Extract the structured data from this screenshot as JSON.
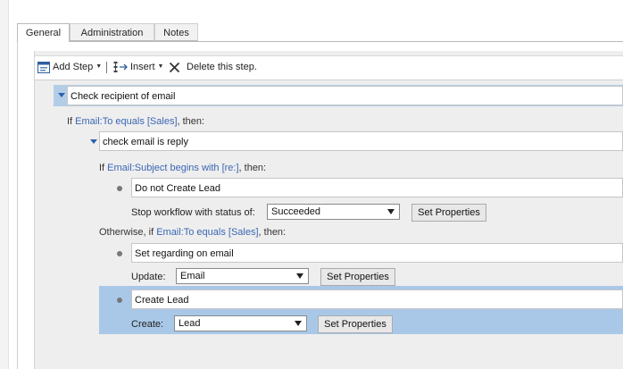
{
  "tabs": [
    {
      "label": "General",
      "active": true
    },
    {
      "label": "Administration",
      "active": false
    },
    {
      "label": "Notes",
      "active": false
    }
  ],
  "toolbar": {
    "add_step": "Add Step",
    "insert": "Insert",
    "delete": "Delete this step.",
    "icons": [
      "add-step-icon",
      "insert-icon",
      "delete-x-icon",
      "dropdown-caret-icon"
    ]
  },
  "workflow": {
    "stage_1": {
      "name": "Check recipient of email"
    },
    "cond_1": {
      "prefix": "If ",
      "link": "Email:To equals [Sales]",
      "suffix": ", then:"
    },
    "stage_2": {
      "name": "check email is reply"
    },
    "cond_2": {
      "prefix": "If ",
      "link": "Email:Subject begins with [re:]",
      "suffix": ", then:"
    },
    "step_1": {
      "name": "Do not Create Lead",
      "label": "Stop workflow with status of:",
      "value": "Succeeded",
      "button": "Set Properties"
    },
    "cond_3": {
      "prefix": "Otherwise, if ",
      "link": "Email:To equals [Sales]",
      "suffix": ", then:"
    },
    "step_2": {
      "name": "Set regarding on email",
      "label": "Update:",
      "value": "Email",
      "button": "Set Properties"
    },
    "step_3": {
      "name": "Create Lead",
      "label": "Create:",
      "value": "Lead",
      "button": "Set Properties"
    }
  },
  "colors": {
    "link": "#3a67b4",
    "selected_row": "#a9c8e8",
    "stage_highlight": "#b3cde6",
    "canvas": "#eeeeee"
  }
}
